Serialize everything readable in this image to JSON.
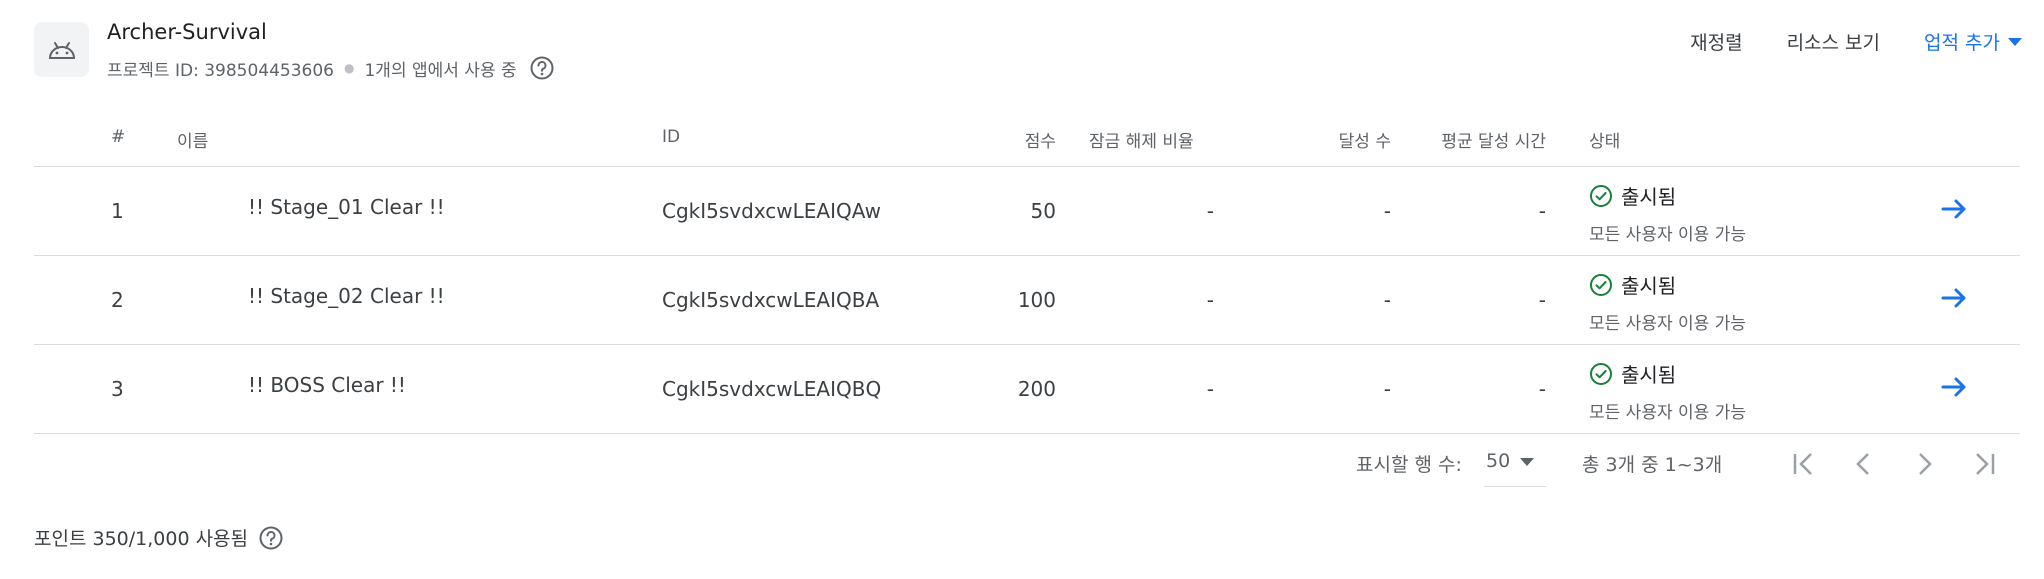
{
  "app": {
    "icon": "android-icon",
    "title": "Archer-Survival",
    "project_id_label": "프로젝트 ID: 398504453606",
    "usage_label": "1개의 앱에서 사용 중"
  },
  "actions": {
    "reorder": "재정렬",
    "view_resources": "리소스 보기",
    "add_achievement": "업적 추가"
  },
  "table": {
    "headers": {
      "num": "#",
      "name": "이름",
      "id": "ID",
      "score": "점수",
      "unlock_rate": "잠금 해제 비율",
      "count": "달성 수",
      "avg_time": "평균 달성 시간",
      "status": "상태"
    },
    "rows": [
      {
        "num": "1",
        "name": "!! Stage_01 Clear !!",
        "id": "CgkI5svdxcwLEAIQAw",
        "score": "50",
        "unlock_rate": "-",
        "count": "-",
        "avg_time": "-",
        "status": "출시됨",
        "status_sub": "모든 사용자 이용 가능"
      },
      {
        "num": "2",
        "name": "!! Stage_02 Clear !!",
        "id": "CgkI5svdxcwLEAIQBA",
        "score": "100",
        "unlock_rate": "-",
        "count": "-",
        "avg_time": "-",
        "status": "출시됨",
        "status_sub": "모든 사용자 이용 가능"
      },
      {
        "num": "3",
        "name": "!! BOSS Clear !!",
        "id": "CgkI5svdxcwLEAIQBQ",
        "score": "200",
        "unlock_rate": "-",
        "count": "-",
        "avg_time": "-",
        "status": "출시됨",
        "status_sub": "모든 사용자 이용 가능"
      }
    ]
  },
  "pagination": {
    "rows_label": "표시할 행 수:",
    "rows_value": "50",
    "range_label": "총 3개 중 1~3개"
  },
  "points": {
    "label": "포인트 350/1,000 사용됨"
  },
  "colors": {
    "accent": "#1a73e8",
    "success": "#188038",
    "text_secondary": "#5f6368",
    "divider": "#dadce0"
  }
}
